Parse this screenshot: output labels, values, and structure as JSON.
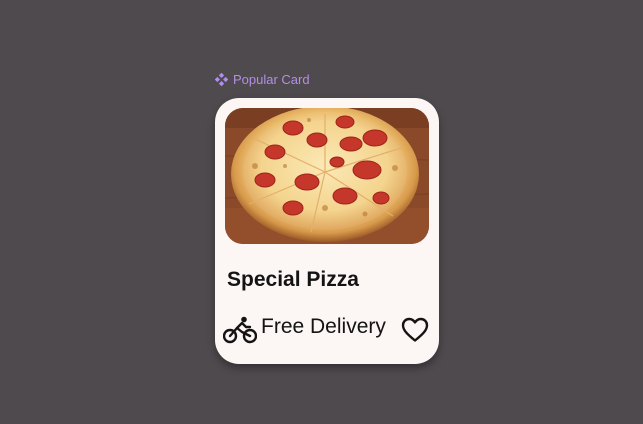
{
  "component_label": "Popular Card",
  "card": {
    "image_icon": "pepperoni-pizza-photo",
    "title": "Special Pizza",
    "delivery_label": "Free Delivery",
    "delivery_icon": "bicycle-icon",
    "favorite_icon": "heart-outline-icon"
  },
  "colors": {
    "background": "#4e4a4e",
    "card": "#fcf6f5",
    "component_label": "#b28ee6",
    "text": "#141414"
  }
}
